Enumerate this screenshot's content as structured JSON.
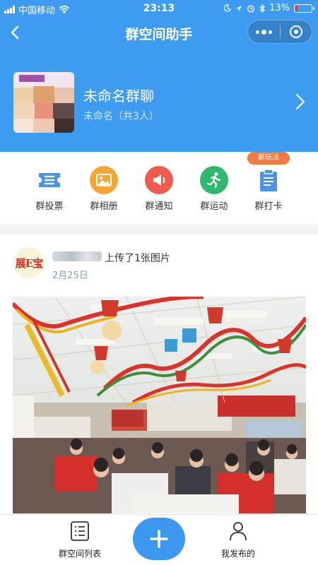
{
  "status_bar": {
    "carrier": "中国移动",
    "time": "23:13",
    "battery": "13%",
    "battery_level": 0.13
  },
  "nav": {
    "title": "群空间助手",
    "icons": [
      "back-arrow-icon",
      "more-dots-icon",
      "close-circle-icon"
    ]
  },
  "group": {
    "name": "未命名群聊",
    "subtitle": "未命名（共3人）"
  },
  "actions": [
    {
      "label": "群投票",
      "icon": "vote-ticket-icon",
      "color": "#4a93ea"
    },
    {
      "label": "群相册",
      "icon": "photo-album-icon",
      "color": "#f4a632"
    },
    {
      "label": "群通知",
      "icon": "megaphone-icon",
      "color": "#ef5a4f"
    },
    {
      "label": "群运动",
      "icon": "running-person-icon",
      "color": "#2fb86b"
    },
    {
      "label": "群打卡",
      "icon": "clipboard-icon",
      "color": "#4a93ea"
    }
  ],
  "new_badge": "新玩法",
  "post": {
    "avatar_text": "展E宝",
    "text": "上传了1张图片",
    "date": "2月25日"
  },
  "tabbar": {
    "left_label": "群空间列表",
    "right_label": "我发布的",
    "accent": "#3c98ef"
  },
  "colors": {
    "header_blue": "#3d9bf0",
    "date_blue": "#8a9cb8"
  }
}
